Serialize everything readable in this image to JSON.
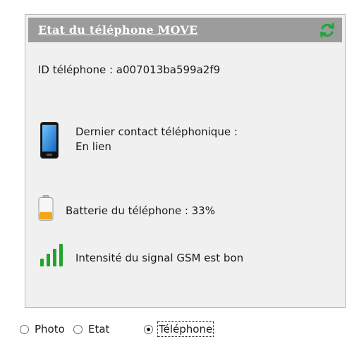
{
  "panel": {
    "title": "Etat du téléphone MOVE",
    "refresh_icon": "refresh-icon",
    "id_text": "ID téléphone : a007013ba599a2f9",
    "contact_label": "Dernier contact téléphonique :",
    "contact_status": "En lien",
    "battery_text": "Batterie du téléphone : 33%",
    "battery_level_percent": 33,
    "signal_text": "Intensité du signal GSM est bon",
    "signal_bars_active": 4,
    "signal_bars_total": 4
  },
  "view_selector": {
    "options": [
      {
        "label": "Photo",
        "selected": false
      },
      {
        "label": "Etat",
        "selected": false
      },
      {
        "label": "Téléphone",
        "selected": true
      }
    ]
  },
  "colors": {
    "header_bg": "#9c9c9c",
    "panel_bg": "#f0f0f0",
    "refresh_green": "#1fa83a",
    "signal_green": "#21a32c",
    "battery_orange": "#f3a51c"
  }
}
